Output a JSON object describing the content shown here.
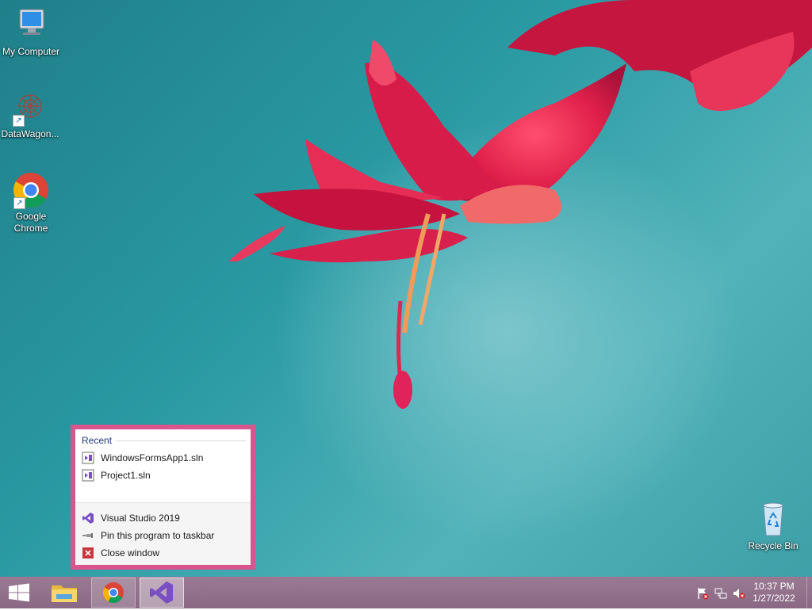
{
  "desktop": {
    "icons": [
      {
        "label": "My Computer",
        "icon": "computer-icon"
      },
      {
        "label": "DataWagon...",
        "icon": "datawagon-icon"
      },
      {
        "label": "Google Chrome",
        "icon": "chrome-icon"
      },
      {
        "label": "Recycle Bin",
        "icon": "recycle-bin-icon"
      }
    ]
  },
  "jumplist": {
    "section_title": "Recent",
    "recent_items": [
      {
        "label": "WindowsFormsApp1.sln",
        "icon": "vs-solution-icon"
      },
      {
        "label": "Project1.sln",
        "icon": "vs-solution-icon"
      }
    ],
    "tasks": [
      {
        "label": "Visual Studio 2019",
        "icon": "visual-studio-icon"
      },
      {
        "label": "Pin this program to taskbar",
        "icon": "pin-icon"
      },
      {
        "label": "Close window",
        "icon": "close-icon"
      }
    ],
    "frame_color": "#d8558d"
  },
  "taskbar": {
    "start_icon": "windows-logo-icon",
    "apps": [
      {
        "name": "File Explorer",
        "icon": "folder-icon"
      },
      {
        "name": "Google Chrome",
        "icon": "chrome-icon"
      },
      {
        "name": "Visual Studio 2019",
        "icon": "visual-studio-icon"
      }
    ],
    "tray_icons": [
      "action-center-flag-icon",
      "network-icon",
      "volume-muted-icon"
    ],
    "clock": {
      "time": "10:37 PM",
      "date": "1/27/2022"
    }
  }
}
